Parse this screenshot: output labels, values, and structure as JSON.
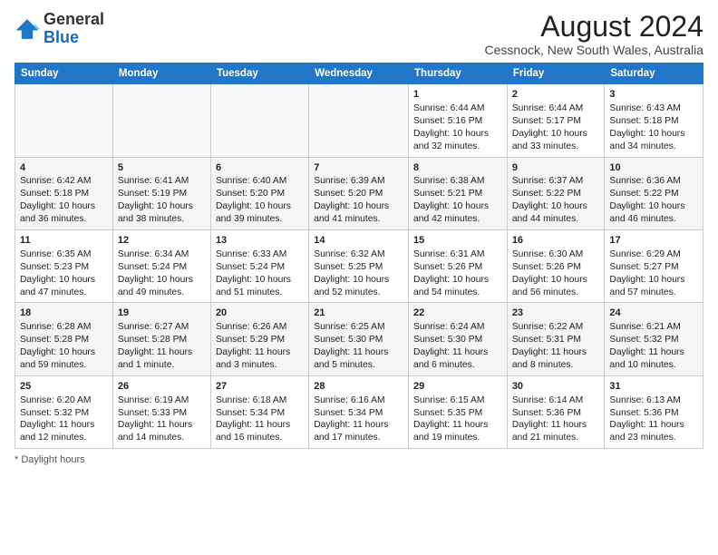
{
  "header": {
    "logo": {
      "general": "General",
      "blue": "Blue"
    },
    "title": "August 2024",
    "subtitle": "Cessnock, New South Wales, Australia"
  },
  "calendar": {
    "days": [
      "Sunday",
      "Monday",
      "Tuesday",
      "Wednesday",
      "Thursday",
      "Friday",
      "Saturday"
    ],
    "weeks": [
      [
        {
          "day": "",
          "content": ""
        },
        {
          "day": "",
          "content": ""
        },
        {
          "day": "",
          "content": ""
        },
        {
          "day": "",
          "content": ""
        },
        {
          "day": "1",
          "content": "Sunrise: 6:44 AM\nSunset: 5:16 PM\nDaylight: 10 hours and 32 minutes."
        },
        {
          "day": "2",
          "content": "Sunrise: 6:44 AM\nSunset: 5:17 PM\nDaylight: 10 hours and 33 minutes."
        },
        {
          "day": "3",
          "content": "Sunrise: 6:43 AM\nSunset: 5:18 PM\nDaylight: 10 hours and 34 minutes."
        }
      ],
      [
        {
          "day": "4",
          "content": "Sunrise: 6:42 AM\nSunset: 5:18 PM\nDaylight: 10 hours and 36 minutes."
        },
        {
          "day": "5",
          "content": "Sunrise: 6:41 AM\nSunset: 5:19 PM\nDaylight: 10 hours and 38 minutes."
        },
        {
          "day": "6",
          "content": "Sunrise: 6:40 AM\nSunset: 5:20 PM\nDaylight: 10 hours and 39 minutes."
        },
        {
          "day": "7",
          "content": "Sunrise: 6:39 AM\nSunset: 5:20 PM\nDaylight: 10 hours and 41 minutes."
        },
        {
          "day": "8",
          "content": "Sunrise: 6:38 AM\nSunset: 5:21 PM\nDaylight: 10 hours and 42 minutes."
        },
        {
          "day": "9",
          "content": "Sunrise: 6:37 AM\nSunset: 5:22 PM\nDaylight: 10 hours and 44 minutes."
        },
        {
          "day": "10",
          "content": "Sunrise: 6:36 AM\nSunset: 5:22 PM\nDaylight: 10 hours and 46 minutes."
        }
      ],
      [
        {
          "day": "11",
          "content": "Sunrise: 6:35 AM\nSunset: 5:23 PM\nDaylight: 10 hours and 47 minutes."
        },
        {
          "day": "12",
          "content": "Sunrise: 6:34 AM\nSunset: 5:24 PM\nDaylight: 10 hours and 49 minutes."
        },
        {
          "day": "13",
          "content": "Sunrise: 6:33 AM\nSunset: 5:24 PM\nDaylight: 10 hours and 51 minutes."
        },
        {
          "day": "14",
          "content": "Sunrise: 6:32 AM\nSunset: 5:25 PM\nDaylight: 10 hours and 52 minutes."
        },
        {
          "day": "15",
          "content": "Sunrise: 6:31 AM\nSunset: 5:26 PM\nDaylight: 10 hours and 54 minutes."
        },
        {
          "day": "16",
          "content": "Sunrise: 6:30 AM\nSunset: 5:26 PM\nDaylight: 10 hours and 56 minutes."
        },
        {
          "day": "17",
          "content": "Sunrise: 6:29 AM\nSunset: 5:27 PM\nDaylight: 10 hours and 57 minutes."
        }
      ],
      [
        {
          "day": "18",
          "content": "Sunrise: 6:28 AM\nSunset: 5:28 PM\nDaylight: 10 hours and 59 minutes."
        },
        {
          "day": "19",
          "content": "Sunrise: 6:27 AM\nSunset: 5:28 PM\nDaylight: 11 hours and 1 minute."
        },
        {
          "day": "20",
          "content": "Sunrise: 6:26 AM\nSunset: 5:29 PM\nDaylight: 11 hours and 3 minutes."
        },
        {
          "day": "21",
          "content": "Sunrise: 6:25 AM\nSunset: 5:30 PM\nDaylight: 11 hours and 5 minutes."
        },
        {
          "day": "22",
          "content": "Sunrise: 6:24 AM\nSunset: 5:30 PM\nDaylight: 11 hours and 6 minutes."
        },
        {
          "day": "23",
          "content": "Sunrise: 6:22 AM\nSunset: 5:31 PM\nDaylight: 11 hours and 8 minutes."
        },
        {
          "day": "24",
          "content": "Sunrise: 6:21 AM\nSunset: 5:32 PM\nDaylight: 11 hours and 10 minutes."
        }
      ],
      [
        {
          "day": "25",
          "content": "Sunrise: 6:20 AM\nSunset: 5:32 PM\nDaylight: 11 hours and 12 minutes."
        },
        {
          "day": "26",
          "content": "Sunrise: 6:19 AM\nSunset: 5:33 PM\nDaylight: 11 hours and 14 minutes."
        },
        {
          "day": "27",
          "content": "Sunrise: 6:18 AM\nSunset: 5:34 PM\nDaylight: 11 hours and 16 minutes."
        },
        {
          "day": "28",
          "content": "Sunrise: 6:16 AM\nSunset: 5:34 PM\nDaylight: 11 hours and 17 minutes."
        },
        {
          "day": "29",
          "content": "Sunrise: 6:15 AM\nSunset: 5:35 PM\nDaylight: 11 hours and 19 minutes."
        },
        {
          "day": "30",
          "content": "Sunrise: 6:14 AM\nSunset: 5:36 PM\nDaylight: 11 hours and 21 minutes."
        },
        {
          "day": "31",
          "content": "Sunrise: 6:13 AM\nSunset: 5:36 PM\nDaylight: 11 hours and 23 minutes."
        }
      ]
    ]
  },
  "footer": {
    "note": "Daylight hours"
  }
}
